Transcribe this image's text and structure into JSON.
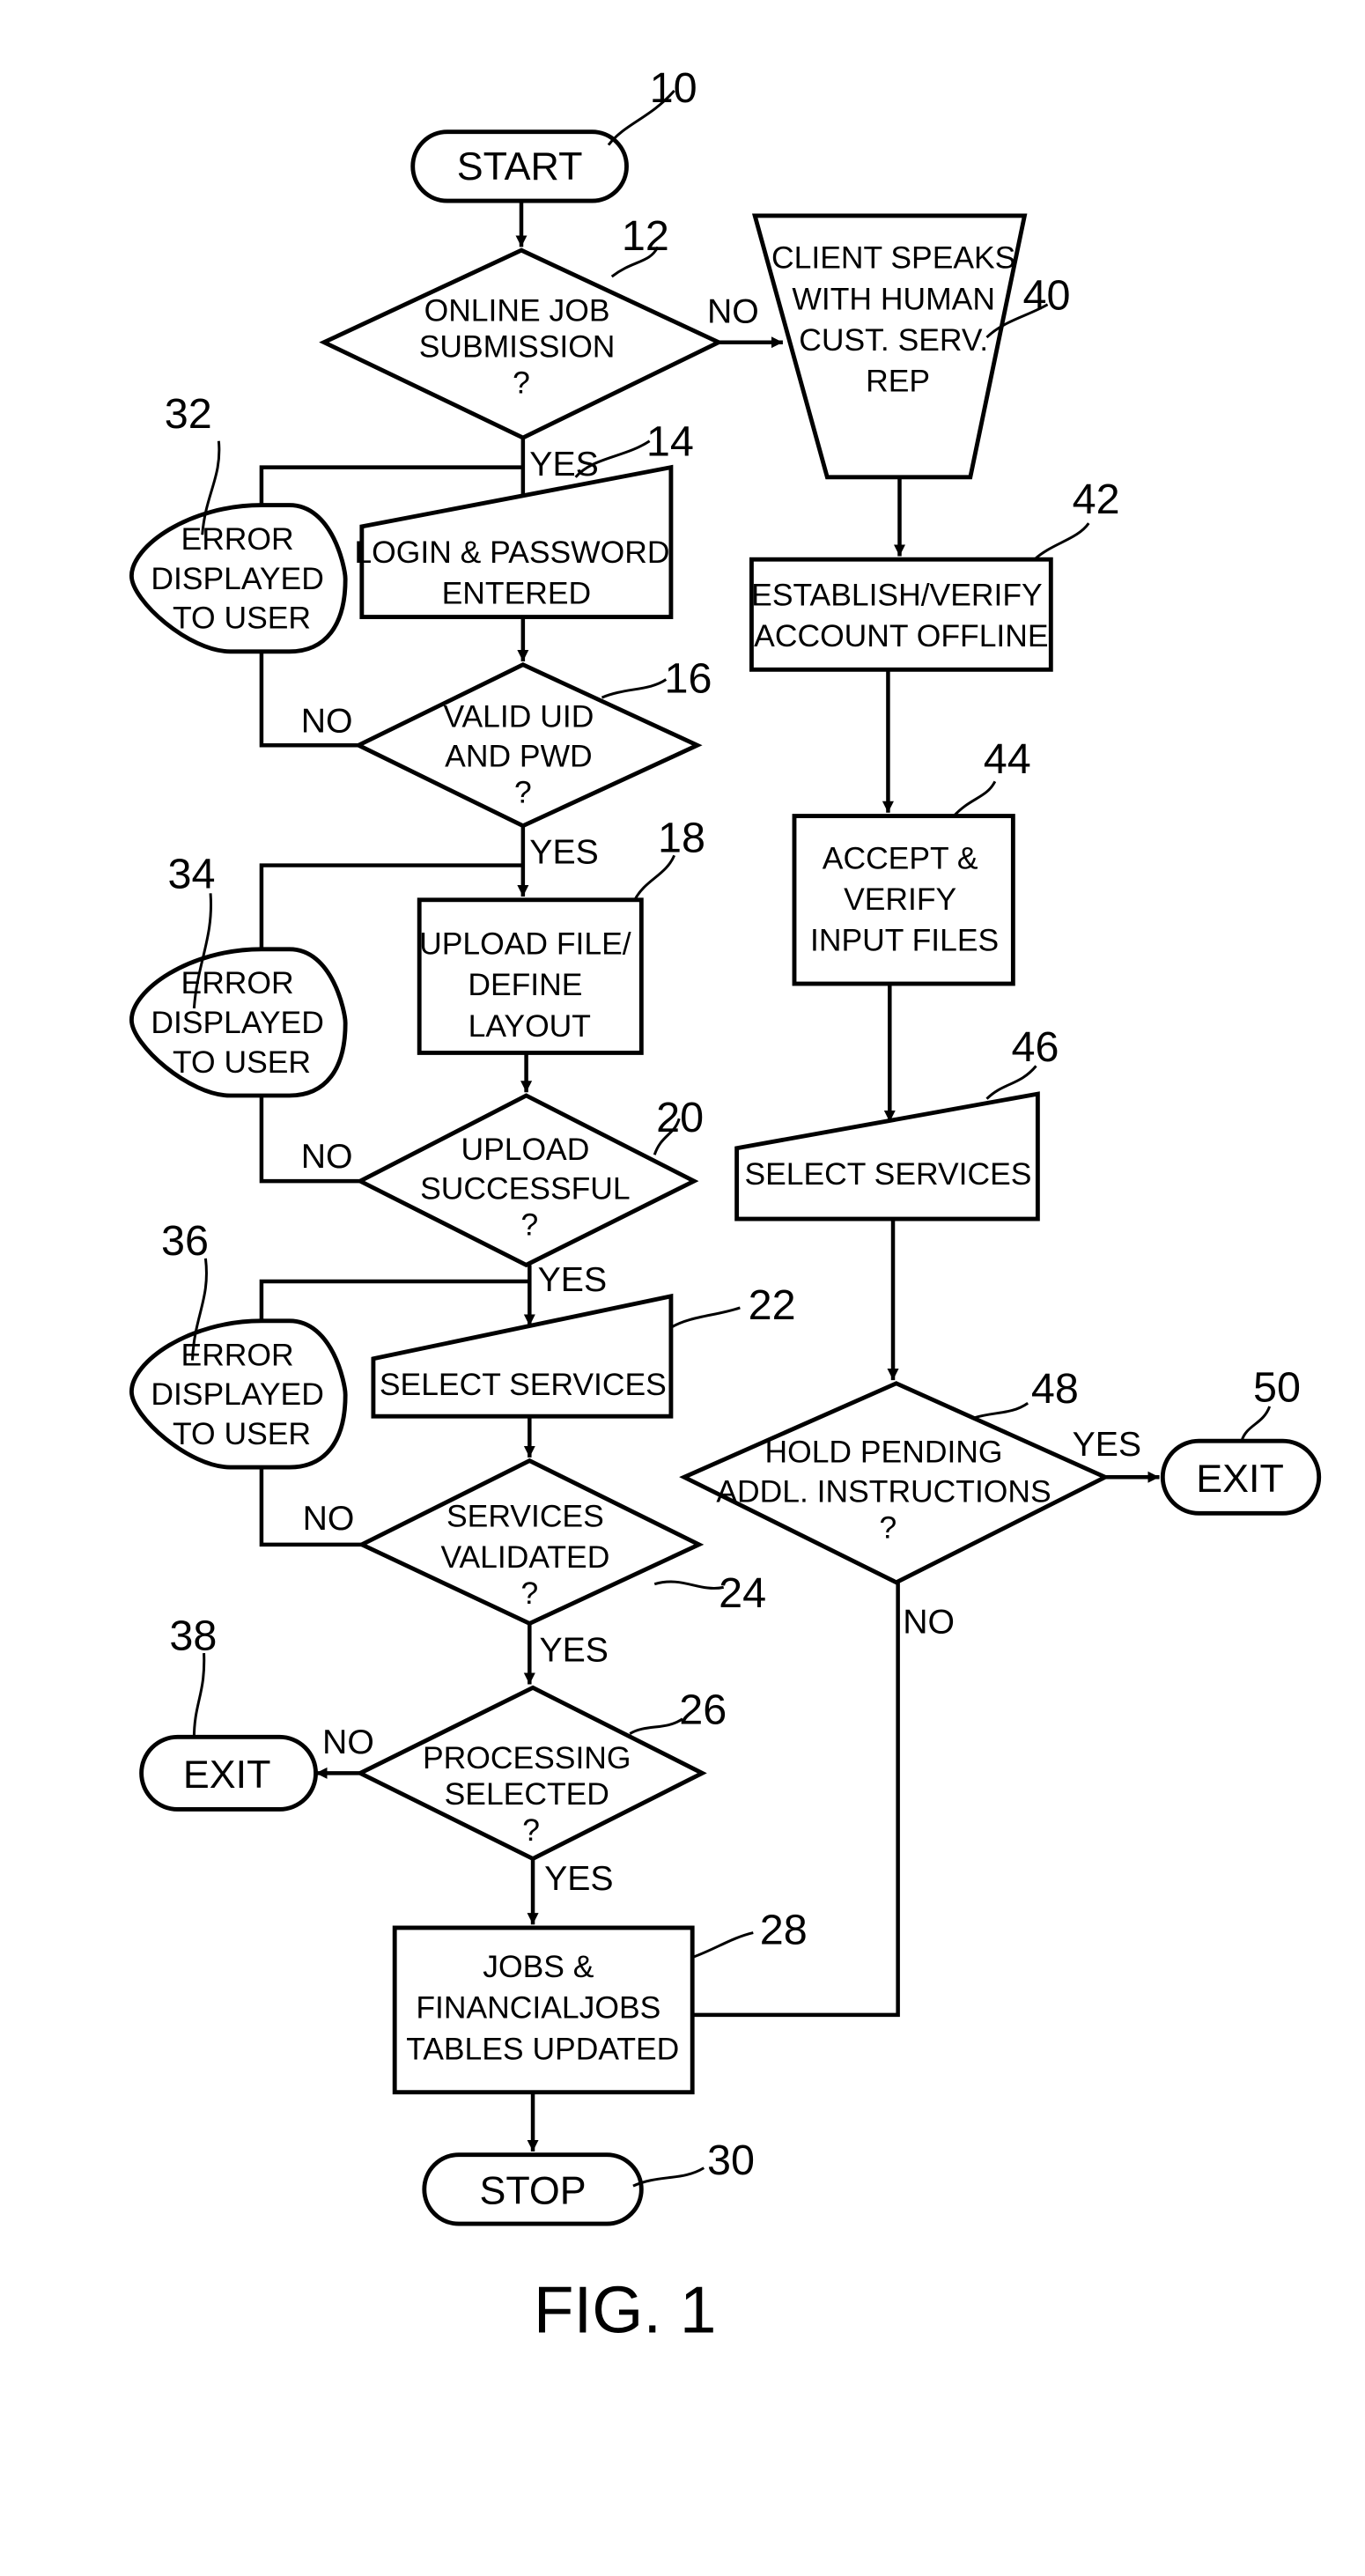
{
  "figure_label": "FIG. 1",
  "nodes": {
    "start": {
      "ref": "10",
      "lines": [
        "START"
      ]
    },
    "online_job": {
      "ref": "12",
      "lines": [
        "ONLINE JOB",
        "SUBMISSION",
        "?"
      ]
    },
    "login": {
      "ref": "14",
      "lines": [
        "LOGIN & PASSWORD",
        "ENTERED"
      ]
    },
    "valid_uid": {
      "ref": "16",
      "lines": [
        "VALID UID",
        "AND PWD",
        "?"
      ]
    },
    "upload": {
      "ref": "18",
      "lines": [
        "UPLOAD FILE/",
        "DEFINE",
        "LAYOUT"
      ]
    },
    "upload_ok": {
      "ref": "20",
      "lines": [
        "UPLOAD",
        "SUCCESSFUL",
        "?"
      ]
    },
    "select1": {
      "ref": "22",
      "lines": [
        "SELECT SERVICES"
      ]
    },
    "validated": {
      "ref": "24",
      "lines": [
        "SERVICES",
        "VALIDATED",
        "?"
      ]
    },
    "processing": {
      "ref": "26",
      "lines": [
        "PROCESSING",
        "SELECTED",
        "?"
      ]
    },
    "tables": {
      "ref": "28",
      "lines": [
        "JOBS &",
        "FINANCIALJOBS",
        "TABLES UPDATED"
      ]
    },
    "stop": {
      "ref": "30",
      "lines": [
        "STOP"
      ]
    },
    "err32": {
      "ref": "32",
      "lines": [
        "ERROR",
        "DISPLAYED",
        "TO USER"
      ]
    },
    "err34": {
      "ref": "34",
      "lines": [
        "ERROR",
        "DISPLAYED",
        "TO USER"
      ]
    },
    "err36": {
      "ref": "36",
      "lines": [
        "ERROR",
        "DISPLAYED",
        "TO USER"
      ]
    },
    "exit38": {
      "ref": "38",
      "lines": [
        "EXIT"
      ]
    },
    "client": {
      "ref": "40",
      "lines": [
        "CLIENT SPEAKS",
        "WITH HUMAN",
        "CUST. SERV.",
        "REP"
      ]
    },
    "establish": {
      "ref": "42",
      "lines": [
        "ESTABLISH/VERIFY",
        "ACCOUNT OFFLINE"
      ]
    },
    "accept": {
      "ref": "44",
      "lines": [
        "ACCEPT &",
        "VERIFY",
        "INPUT FILES"
      ]
    },
    "select2": {
      "ref": "46",
      "lines": [
        "SELECT SERVICES"
      ]
    },
    "hold": {
      "ref": "48",
      "lines": [
        "HOLD PENDING",
        "ADDL. INSTRUCTIONS",
        "?"
      ]
    },
    "exit50": {
      "ref": "50",
      "lines": [
        "EXIT"
      ]
    }
  },
  "edge_labels": {
    "online_no": "NO",
    "online_yes": "YES",
    "uid_no": "NO",
    "uid_yes": "YES",
    "upload_no": "NO",
    "upload_yes": "YES",
    "validated_no": "NO",
    "validated_yes": "YES",
    "processing_no": "NO",
    "processing_yes": "YES",
    "hold_yes": "YES",
    "hold_no": "NO"
  }
}
